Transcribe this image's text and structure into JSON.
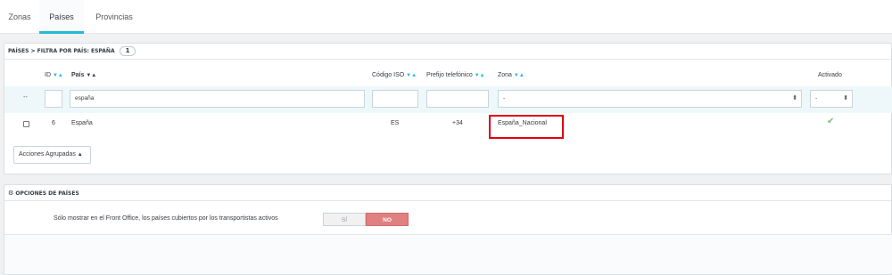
{
  "tabs": [
    {
      "label": "Zonas",
      "active": false
    },
    {
      "label": "Países",
      "active": true
    },
    {
      "label": "Provincias",
      "active": false
    }
  ],
  "list_panel": {
    "title": "PAÍSES > FILTRA POR PAÍS: ESPAÑA",
    "count_badge": "1",
    "columns": {
      "id": "ID",
      "pais": "País",
      "codigo_iso": "Código ISO",
      "prefijo": "Prefijo telefónico",
      "zona": "Zona",
      "activado": "Activado"
    },
    "filters": {
      "dash": "--",
      "pais_value": "españa",
      "zona_value": "-",
      "activado_value": "-"
    },
    "rows": [
      {
        "id": "6",
        "pais": "España",
        "codigo_iso": "ES",
        "prefijo": "+34",
        "zona": "España_Nacional",
        "activado": true
      }
    ],
    "bulk_actions_label": "Acciones Agrupadas"
  },
  "options_panel": {
    "title": "OPCIONES DE PAÍSES",
    "option_label": "Sólo mostrar en el Front Office, los países cubiertos por los transportistas activos",
    "toggle_yes": "SÍ",
    "toggle_no": "NO",
    "selected": "NO"
  },
  "colors": {
    "accent": "#25b9d7",
    "highlight_border": "#e00010",
    "toggle_no_active": "#e08080",
    "check_green": "#72c279"
  }
}
